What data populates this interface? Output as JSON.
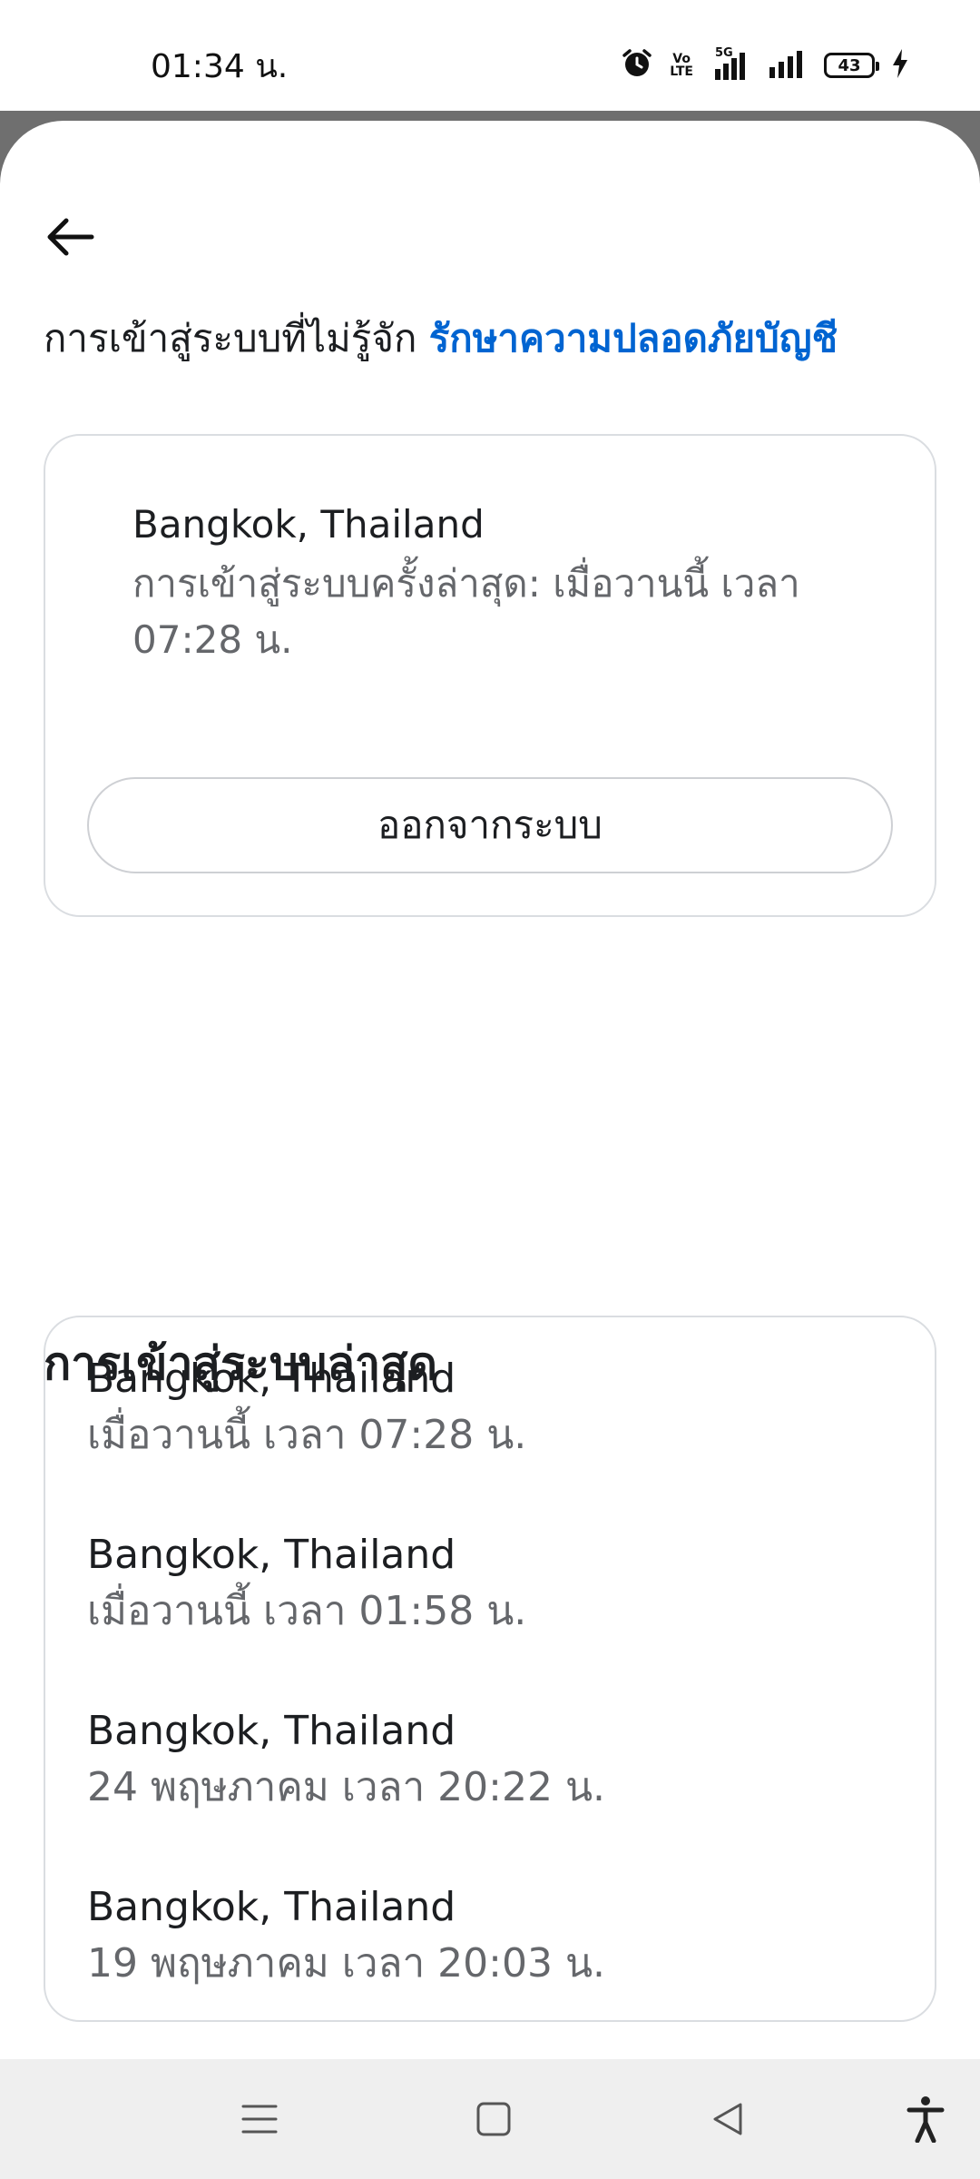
{
  "status_bar": {
    "time": "01:34 น.",
    "battery": "43",
    "volte": "Vo\nLTE",
    "network": "5G"
  },
  "header": {
    "back_icon": "arrow-left-icon"
  },
  "intro": {
    "text": "การเข้าสู่ระบบที่ไม่รู้จัก ",
    "link": "รักษาความปลอดภัยบัญชี"
  },
  "current_session": {
    "location": "Bangkok, Thailand",
    "detail": "การเข้าสู่ระบบครั้งล่าสุด: เมื่อวานนี้ เวลา 07:28 น.",
    "logout_label": "ออกจากระบบ"
  },
  "recent_logins": {
    "title": "การเข้าสู่ระบบล่าสุด",
    "items": [
      {
        "location": "Bangkok, Thailand",
        "time": "เมื่อวานนี้ เวลา 07:28 น."
      },
      {
        "location": "Bangkok, Thailand",
        "time": "เมื่อวานนี้ เวลา 01:58 น."
      },
      {
        "location": "Bangkok, Thailand",
        "time": "24 พฤษภาคม เวลา 20:22 น."
      },
      {
        "location": "Bangkok, Thailand",
        "time": "19 พฤษภาคม เวลา 20:03 น."
      }
    ]
  },
  "nav": {
    "icons": [
      "menu-icon",
      "home-square-icon",
      "back-triangle-icon",
      "accessibility-icon"
    ]
  },
  "colors": {
    "link": "#0064d1",
    "secondary_text": "#65676b",
    "border": "#dadde1"
  }
}
